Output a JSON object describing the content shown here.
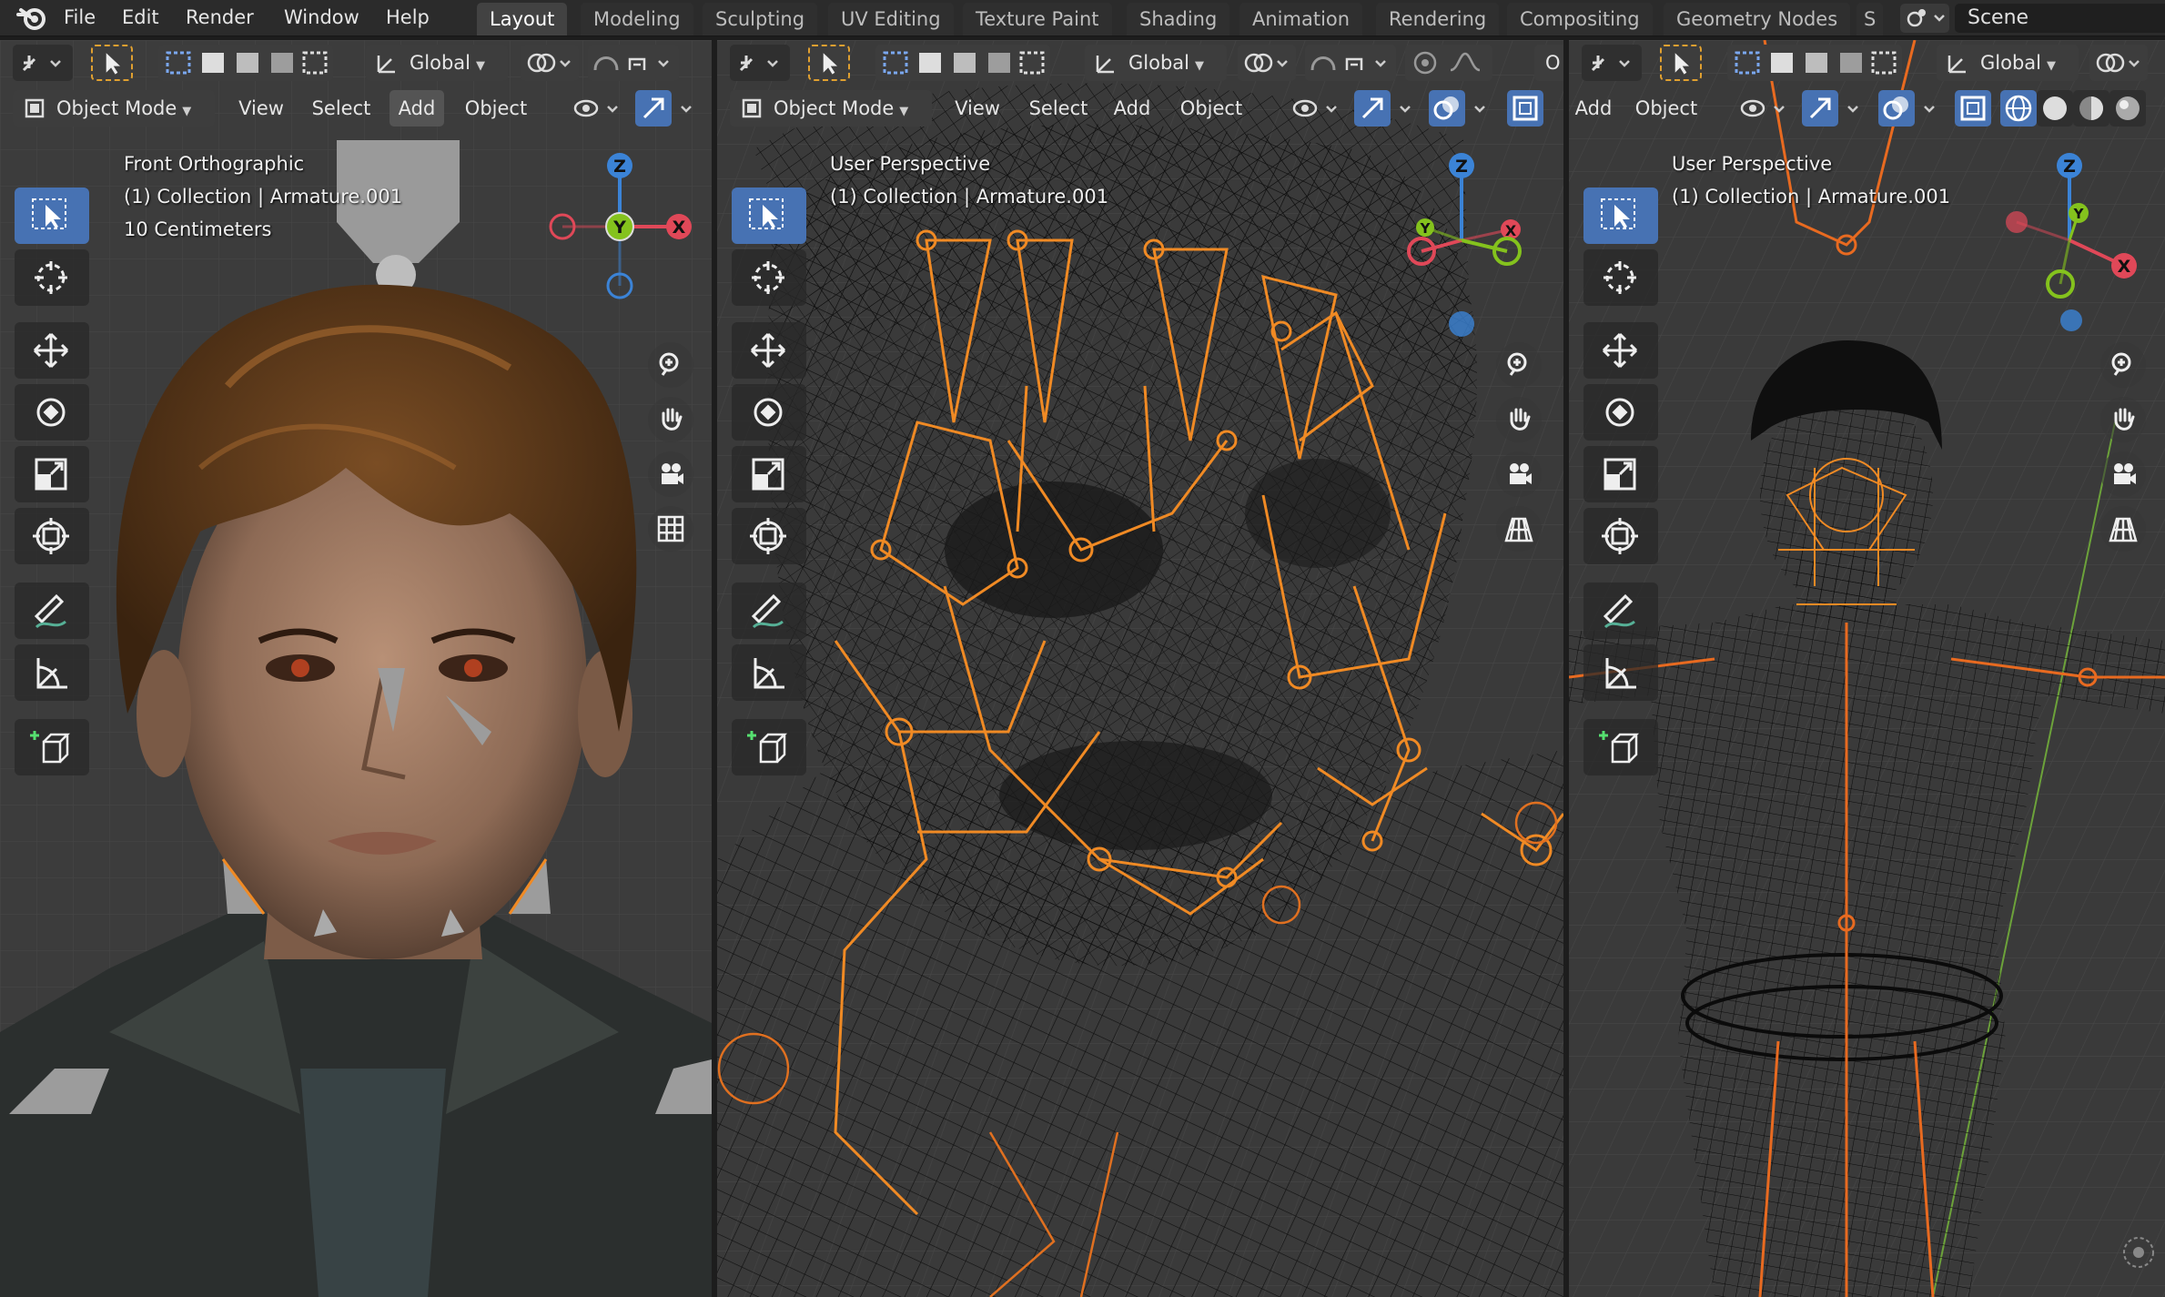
{
  "app": {
    "menus": [
      "File",
      "Edit",
      "Render",
      "Window",
      "Help"
    ],
    "workspace_tabs": [
      "Layout",
      "Modeling",
      "Sculpting",
      "UV Editing",
      "Texture Paint",
      "Shading",
      "Animation",
      "Rendering",
      "Compositing",
      "Geometry Nodes",
      "S"
    ],
    "active_tab": "Layout",
    "scene_name": "Scene"
  },
  "viewport1": {
    "orientation": "Global",
    "mode": "Object Mode",
    "menus": [
      "View",
      "Select",
      "Add",
      "Object"
    ],
    "view_name": "Front Orthographic",
    "collection": "(1) Collection | Armature.001",
    "scale": "10 Centimeters"
  },
  "viewport2": {
    "orientation": "Global",
    "mode": "Object Mode",
    "menus": [
      "View",
      "Select",
      "Add",
      "Object"
    ],
    "view_name": "User Perspective",
    "collection": "(1) Collection | Armature.001",
    "truncated_label": "O"
  },
  "viewport3": {
    "orientation": "Global",
    "menus": [
      "Add",
      "Object"
    ],
    "view_name": "User Perspective",
    "collection": "(1) Collection | Armature.001"
  },
  "gizmo_axes": {
    "x": "X",
    "y": "Y",
    "z": "Z"
  },
  "colors": {
    "accent_blue": "#4772b3",
    "axis_x": "#e04858",
    "axis_y": "#84c21d",
    "axis_z": "#3b83d6",
    "bone_orange": "#f08a24",
    "wire_black": "#0b0b0b"
  },
  "icons": [
    "blender-logo",
    "scene-icon",
    "select-box-icon",
    "cursor-icon",
    "move-icon",
    "rotate-icon",
    "scale-icon",
    "transform-icon",
    "annotate-icon",
    "measure-icon",
    "add-cube-icon",
    "zoom-icon",
    "hand-icon",
    "camera-icon",
    "grid-icon"
  ]
}
